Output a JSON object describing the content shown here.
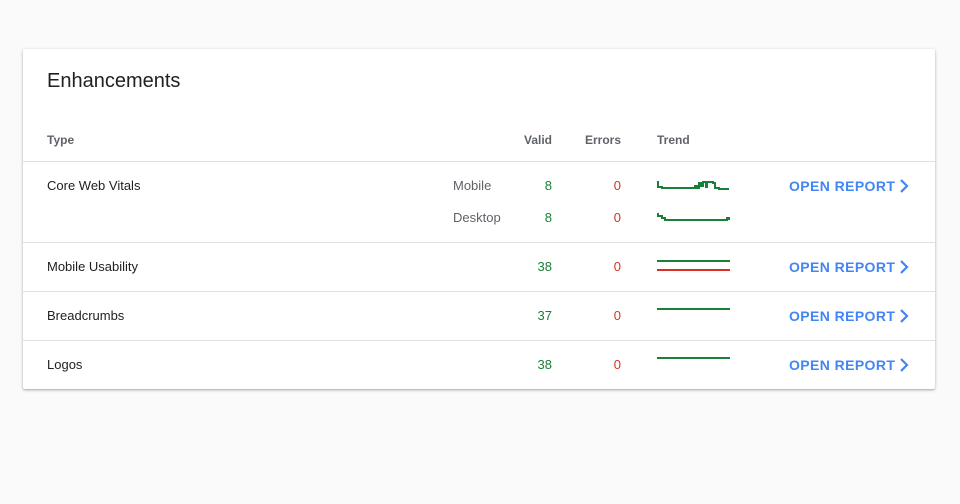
{
  "card": {
    "title": "Enhancements"
  },
  "table": {
    "headers": {
      "type": "Type",
      "valid": "Valid",
      "errors": "Errors",
      "trend": "Trend"
    },
    "open_report_label": "OPEN REPORT",
    "rows": [
      {
        "name": "Core Web Vitals",
        "devices": [
          {
            "device": "Mobile",
            "valid": "8",
            "errors": "0"
          },
          {
            "device": "Desktop",
            "valid": "8",
            "errors": "0"
          }
        ]
      },
      {
        "name": "Mobile Usability",
        "valid": "38",
        "errors": "0"
      },
      {
        "name": "Breadcrumbs",
        "valid": "37",
        "errors": "0"
      },
      {
        "name": "Logos",
        "valid": "38",
        "errors": "0"
      }
    ]
  },
  "colors": {
    "valid": "#188038",
    "error": "#d93025",
    "link": "#4285f4"
  },
  "icons": {
    "open_report": "chevron-right-icon"
  }
}
